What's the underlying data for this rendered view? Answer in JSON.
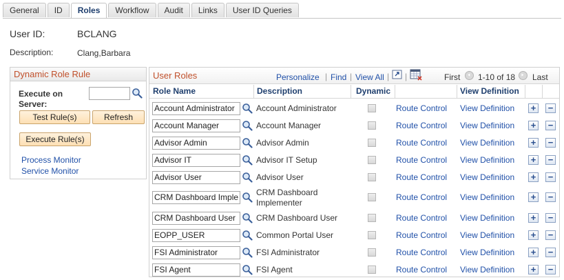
{
  "tabs": [
    "General",
    "ID",
    "Roles",
    "Workflow",
    "Audit",
    "Links",
    "User ID Queries"
  ],
  "active_tab": "Roles",
  "user": {
    "id_label": "User ID:",
    "id_value": "BCLANG",
    "desc_label": "Description:",
    "desc_value": "Clang,Barbara"
  },
  "dynamic_role_rule": {
    "title": "Dynamic Role Rule",
    "execute_label": "Execute on Server:",
    "server_value": "",
    "test_rules_button": "Test Rule(s)",
    "refresh_button": "Refresh",
    "execute_rules_button": "Execute Rule(s)",
    "process_monitor_link": "Process Monitor",
    "service_monitor_link": "Service Monitor"
  },
  "user_roles": {
    "title": "User Roles",
    "toolbar": {
      "personalize": "Personalize",
      "find": "Find",
      "view_all": "View All",
      "first": "First",
      "range": "1-10 of 18",
      "last": "Last"
    },
    "columns": {
      "role_name": "Role Name",
      "description": "Description",
      "dynamic": "Dynamic",
      "view_definition": "View Definition"
    },
    "rows": [
      {
        "role": "Account Administrator",
        "desc": "Account Administrator",
        "desc2": "",
        "route": "Route Control",
        "view": "View Definition"
      },
      {
        "role": "Account Manager",
        "desc": "Account Manager",
        "desc2": "",
        "route": "Route Control",
        "view": "View Definition"
      },
      {
        "role": "Advisor Admin",
        "desc": "Advisor Admin",
        "desc2": "",
        "route": "Route Control",
        "view": "View Definition"
      },
      {
        "role": "Advisor IT",
        "desc": "Advisor IT Setup",
        "desc2": "",
        "route": "Route Control",
        "view": "View Definition"
      },
      {
        "role": "Advisor User",
        "desc": "Advisor User",
        "desc2": "",
        "route": "Route Control",
        "view": "View Definition"
      },
      {
        "role": "CRM Dashboard Imple",
        "desc": "CRM Dashboard",
        "desc2": "Implementer",
        "route": "Route Control",
        "view": "View Definition"
      },
      {
        "role": "CRM Dashboard User",
        "desc": "CRM Dashboard User",
        "desc2": "",
        "route": "Route Control",
        "view": "View Definition"
      },
      {
        "role": "EOPP_USER",
        "desc": "Common Portal User",
        "desc2": "",
        "route": "Route Control",
        "view": "View Definition"
      },
      {
        "role": "FSI Administrator",
        "desc": "FSI Administrator",
        "desc2": "",
        "route": "Route Control",
        "view": "View Definition"
      },
      {
        "role": "FSI Agent",
        "desc": "FSI Agent",
        "desc2": "",
        "route": "Route Control",
        "view": "View Definition"
      }
    ]
  },
  "icons": {
    "lookup": "magnifier-icon",
    "zoom": "zoom-icon",
    "download": "spreadsheet-icon",
    "prev": "previous-arrow-icon",
    "next": "next-arrow-icon",
    "add": "plus",
    "remove": "minus"
  },
  "colors": {
    "link": "#2050a8",
    "section_title": "#c0502b",
    "header_text": "#1f3f6e",
    "button_bg": "#fde0b4"
  }
}
